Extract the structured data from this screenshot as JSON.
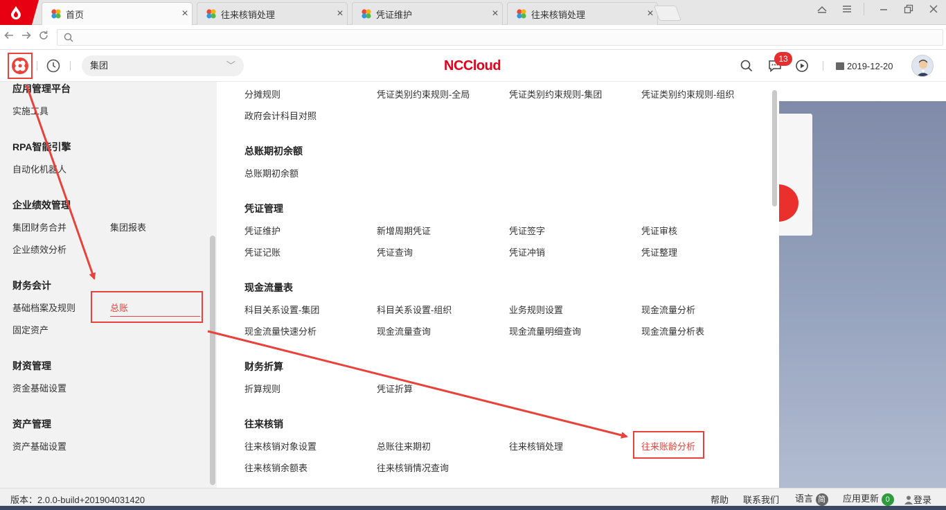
{
  "browser": {
    "tabs": [
      {
        "label": "首页",
        "active": true
      },
      {
        "label": "往来核销处理",
        "active": false
      },
      {
        "label": "凭证维护",
        "active": false
      },
      {
        "label": "往来核销处理",
        "active": false
      }
    ]
  },
  "header": {
    "group": "集团",
    "brand": "NCCloud",
    "badge": "13",
    "date": "2019-12-20"
  },
  "leftnav": {
    "g1_title": "应用管理平台",
    "g1_i1": "实施工具",
    "g2_title": "RPA智能引擎",
    "g2_i1": "自动化机器人",
    "g3_title": "企业绩效管理",
    "g3_i1": "集团财务合并",
    "g3_i2": "集团报表",
    "g3_i3": "企业绩效分析",
    "g4_title": "财务会计",
    "g4_i1": "基础档案及规则",
    "g4_i2": "总账",
    "g4_i3": "固定资产",
    "g5_title": "财资管理",
    "g5_i1": "资金基础设置",
    "g6_title": "资产管理",
    "g6_i1": "资产基础设置"
  },
  "content": {
    "s0_i1": "分摊规则",
    "s0_i2": "凭证类别约束规则-全局",
    "s0_i3": "凭证类别约束规则-集团",
    "s0_i4": "凭证类别约束规则-组织",
    "s0_i5": "政府会计科目对照",
    "s1_title": "总账期初余额",
    "s1_i1": "总账期初余额",
    "s2_title": "凭证管理",
    "s2_i1": "凭证维护",
    "s2_i2": "新增周期凭证",
    "s2_i3": "凭证签字",
    "s2_i4": "凭证审核",
    "s2_i5": "凭证记账",
    "s2_i6": "凭证查询",
    "s2_i7": "凭证冲销",
    "s2_i8": "凭证整理",
    "s3_title": "现金流量表",
    "s3_i1": "科目关系设置-集团",
    "s3_i2": "科目关系设置-组织",
    "s3_i3": "业务规则设置",
    "s3_i4": "现金流量分析",
    "s3_i5": "现金流量快速分析",
    "s3_i6": "现金流量查询",
    "s3_i7": "现金流量明细查询",
    "s3_i8": "现金流量分析表",
    "s4_title": "财务折算",
    "s4_i1": "折算规则",
    "s4_i2": "凭证折算",
    "s5_title": "往来核销",
    "s5_i1": "往来核销对象设置",
    "s5_i2": "总账往来期初",
    "s5_i3": "往来核销处理",
    "s5_i4": "往来账龄分析",
    "s5_i5": "往来核销余额表",
    "s5_i6": "往来核销情况查询"
  },
  "status": {
    "version": "版本：2.0.0-build+201904031420",
    "help": "帮助",
    "contact": "联系我们",
    "language": "语言",
    "language_badge": "简",
    "update": "应用更新",
    "update_count": "0",
    "login": "登录"
  },
  "colors": {
    "accent": "#e8423b",
    "brand": "#e3001b"
  }
}
